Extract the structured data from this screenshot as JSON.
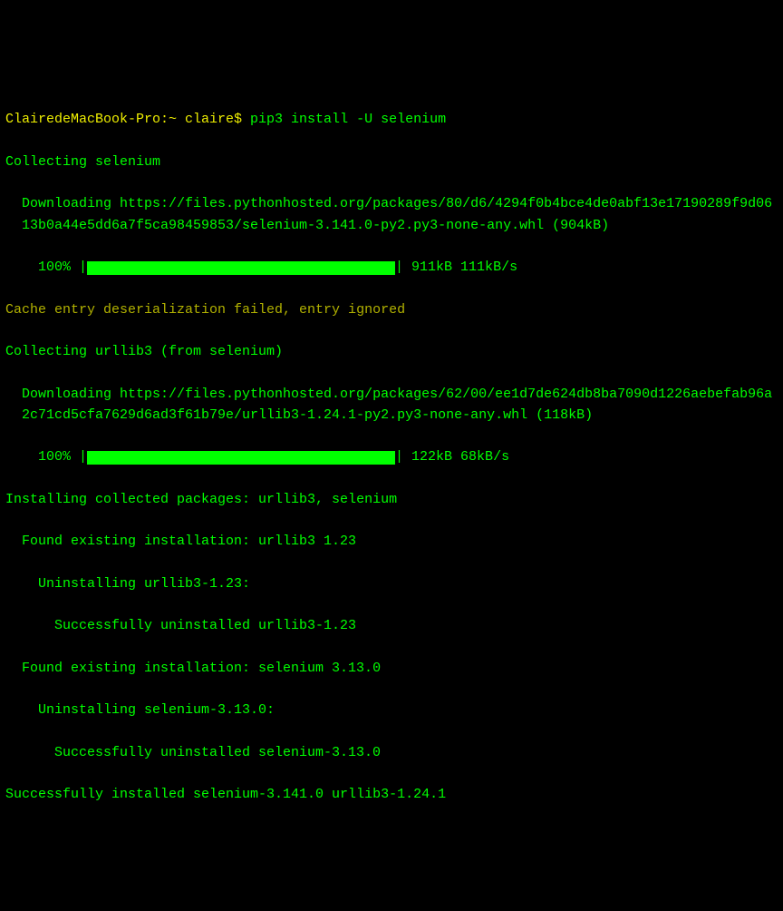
{
  "prompt": {
    "host": "ClairedeMacBook-Pro:~ claire$ ",
    "command": "pip3 install -U selenium"
  },
  "lines": {
    "collecting_selenium": "Collecting selenium",
    "download_selenium": "Downloading https://files.pythonhosted.org/packages/80/d6/4294f0b4bce4de0abf13e17190289f9d0613b0a44e5dd6a7f5ca98459853/selenium-3.141.0-py2.py3-none-any.whl (904kB)",
    "progress1_percent": "100% ",
    "progress1_pipe": "|",
    "progress1_stats": " 911kB 111kB/s",
    "cache_warn": "Cache entry deserialization failed, entry ignored",
    "collecting_urllib3": "Collecting urllib3 (from selenium)",
    "download_urllib3": "Downloading https://files.pythonhosted.org/packages/62/00/ee1d7de624db8ba7090d1226aebefab96a2c71cd5cfa7629d6ad3f61b79e/urllib3-1.24.1-py2.py3-none-any.whl (118kB)",
    "progress2_percent": "100% ",
    "progress2_pipe": "|",
    "progress2_stats": " 122kB 68kB/s",
    "installing": "Installing collected packages: urllib3, selenium",
    "found_urllib3": "Found existing installation: urllib3 1.23",
    "uninstall_urllib3": "Uninstalling urllib3-1.23:",
    "uninstalled_urllib3": "Successfully uninstalled urllib3-1.23",
    "found_selenium": "Found existing installation: selenium 3.13.0",
    "uninstall_selenium": "Uninstalling selenium-3.13.0:",
    "uninstalled_selenium": "Successfully uninstalled selenium-3.13.0",
    "success": "Successfully installed selenium-3.141.0 urllib3-1.24.1"
  }
}
